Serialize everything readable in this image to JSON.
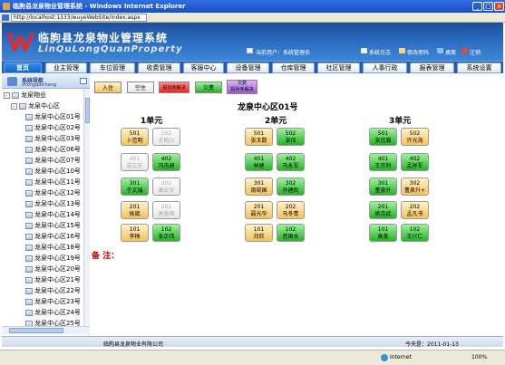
{
  "window": {
    "title": "临朐县龙泉物业管理系统 - Windows Internet Explorer",
    "address": "http://localhost:1333/wuyeWebSite/index.aspx"
  },
  "header": {
    "brand_cn": "临朐县龙泉物业管理系统",
    "brand_en": "LinQuLongQuanProperty",
    "current_user": "当前用户：系统管理员",
    "links": {
      "log": "系统日志",
      "password": "修改密码",
      "desktop": "桌面",
      "logout": "注销"
    }
  },
  "nav": [
    "首页",
    "业主管理",
    "车位管理",
    "收费管理",
    "客服中心",
    "设备管理",
    "仓库管理",
    "社区管理",
    "人事行政",
    "报表管理",
    "系统设置"
  ],
  "sidebar": {
    "title": "系统导航",
    "subtitle": "zhongqiechang",
    "root": "龙泉物业",
    "district": "龙泉中心区",
    "items": [
      "龙泉中心区01号",
      "龙泉中心区02号",
      "龙泉中心区03号",
      "龙泉中心区06号",
      "龙泉中心区07号",
      "龙泉中心区10号",
      "龙泉中心区11号",
      "龙泉中心区12号",
      "龙泉中心区13号",
      "龙泉中心区14号",
      "龙泉中心区15号",
      "龙泉中心区16号",
      "龙泉中心区18号",
      "龙泉中心区19号",
      "龙泉中心区20号",
      "龙泉中心区21号",
      "龙泉中心区22号",
      "龙泉中心区23号",
      "龙泉中心区24号",
      "龙泉中心区25号",
      "龙泉中心区26号"
    ]
  },
  "legend": {
    "occupied": "入住",
    "vacant": "空住",
    "complaint": "投诉未解决",
    "arrears": "欠费",
    "arrears_complaint_1": "欠费",
    "arrears_complaint_2": "投诉未解决"
  },
  "colors": {
    "occupied": "#f6c25d",
    "vacant": "#e8e8e8",
    "arrears": "#27b227",
    "complaint": "#f02020",
    "arrears_complaint": "#9b59d6"
  },
  "main": {
    "complex_title": "龙泉中心区01号",
    "note_label": "备 注：",
    "units": [
      {
        "name": "1单元",
        "rows": [
          [
            {
              "no": "501",
              "owner": "卜范明",
              "s": "occ"
            },
            {
              "no": "502",
              "owner": "王明川",
              "s": "vac"
            }
          ],
          [
            {
              "no": "401",
              "owner": "梁立东",
              "s": "vac"
            },
            {
              "no": "402",
              "owner": "冯吉昶",
              "s": "arr"
            }
          ],
          [
            {
              "no": "301",
              "owner": "于文瑞",
              "s": "arr"
            },
            {
              "no": "302",
              "owner": "秦宏宇",
              "s": "vac"
            }
          ],
          [
            {
              "no": "201",
              "owner": "侯斌",
              "s": "occ"
            },
            {
              "no": "202",
              "owner": "唐墨国",
              "s": "vac"
            }
          ],
          [
            {
              "no": "101",
              "owner": "李梅",
              "s": "occ"
            },
            {
              "no": "102",
              "owner": "张正伟",
              "s": "arr"
            }
          ]
        ]
      },
      {
        "name": "2单元",
        "rows": [
          [
            {
              "no": "501",
              "owner": "张玉数",
              "s": "occ"
            },
            {
              "no": "502",
              "owner": "张伟",
              "s": "arr"
            }
          ],
          [
            {
              "no": "401",
              "owner": "林建",
              "s": "arr"
            },
            {
              "no": "402",
              "owner": "马永军",
              "s": "arr"
            }
          ],
          [
            {
              "no": "301",
              "owner": "周晓国",
              "s": "occ"
            },
            {
              "no": "302",
              "owner": "孙建民",
              "s": "arr"
            }
          ],
          [
            {
              "no": "201",
              "owner": "聂光华",
              "s": "occ"
            },
            {
              "no": "202",
              "owner": "马冬青",
              "s": "occ"
            }
          ],
          [
            {
              "no": "101",
              "owner": "刘欣",
              "s": "occ"
            },
            {
              "no": "102",
              "owner": "宫国水",
              "s": "arr"
            }
          ]
        ]
      },
      {
        "name": "3单元",
        "rows": [
          [
            {
              "no": "501",
              "owner": "张信嵩",
              "s": "arr"
            },
            {
              "no": "502",
              "owner": "许光海",
              "s": "occ"
            }
          ],
          [
            {
              "no": "401",
              "owner": "王宗利",
              "s": "arr"
            },
            {
              "no": "402",
              "owner": "孟祥军",
              "s": "arr"
            }
          ],
          [
            {
              "no": "301",
              "owner": "董泉升",
              "s": "arr"
            },
            {
              "no": "302",
              "owner": "董泉升+",
              "s": "occ"
            }
          ],
          [
            {
              "no": "201",
              "owner": "姚克武",
              "s": "arr"
            },
            {
              "no": "202",
              "owner": "孟凡书",
              "s": "occ"
            }
          ],
          [
            {
              "no": "101",
              "owner": "高美",
              "s": "arr"
            },
            {
              "no": "102",
              "owner": "王兴仁",
              "s": "arr"
            }
          ]
        ]
      }
    ]
  },
  "footer": {
    "company": "临朐县龙泉物业有限公司",
    "today": "今天是：2011-01-13"
  },
  "statusbar": {
    "zone": "Internet",
    "zoom": "100%"
  }
}
